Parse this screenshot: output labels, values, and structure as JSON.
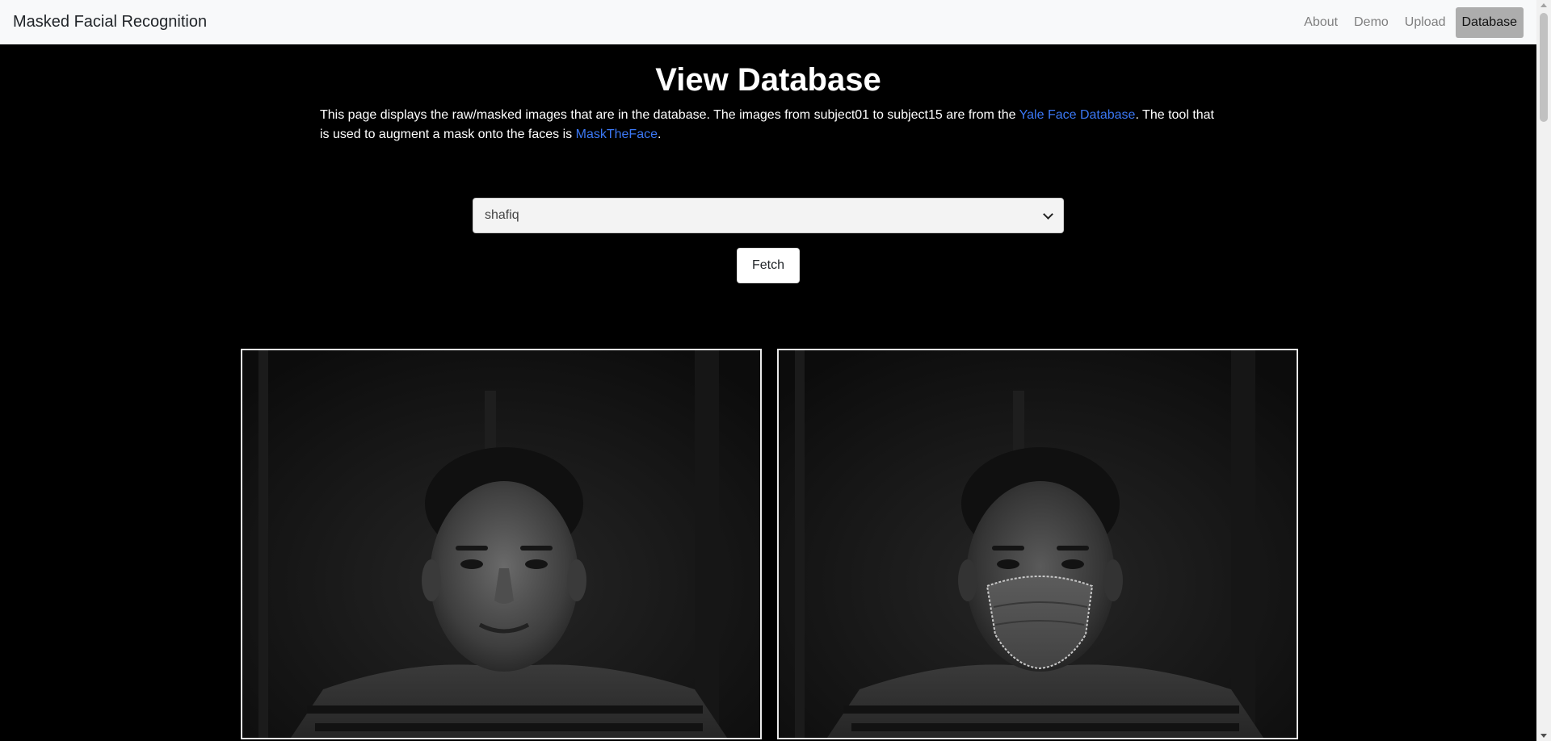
{
  "navbar": {
    "brand": "Masked Facial Recognition",
    "links": [
      {
        "label": "About",
        "active": false
      },
      {
        "label": "Demo",
        "active": false
      },
      {
        "label": "Upload",
        "active": false
      },
      {
        "label": "Database",
        "active": true
      }
    ]
  },
  "main": {
    "title": "View Database",
    "description": {
      "part1": "This page displays the raw/masked images that are in the database. The images from subject01 to subject15 are from the ",
      "link1": "Yale Face Database",
      "part2": ". The tool that is used to augment a mask onto the faces is ",
      "link2": "MaskTheFace",
      "part3": "."
    },
    "select": {
      "selected_value": "shafiq"
    },
    "fetch_label": "Fetch"
  },
  "colors": {
    "page_background": "#000000",
    "navbar_background": "#f8f9fa",
    "link_color": "#3b78f5",
    "active_nav_background": "#adadad"
  }
}
